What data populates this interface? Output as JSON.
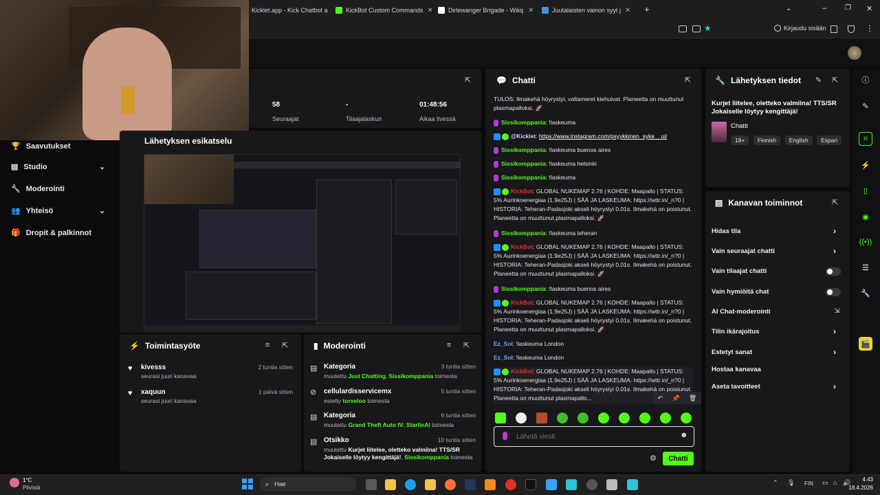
{
  "browser": {
    "tabs": [
      {
        "label": "Kicklet.app - Kick Chatbot a"
      },
      {
        "label": "KickBot Custom Commands"
      },
      {
        "label": "Dirlewanger Brigade - Wikipedi"
      },
      {
        "label": "Juutalaisten vainon syyt ja aika"
      }
    ],
    "signin_label": "Kirjaudu sisään"
  },
  "sidebar": {
    "items": [
      {
        "label": "Saavutukset"
      },
      {
        "label": "Studio"
      },
      {
        "label": "Moderointi"
      },
      {
        "label": "Yhteisö"
      },
      {
        "label": "Dropit & palkinnot"
      }
    ]
  },
  "stats": [
    {
      "value": "58",
      "label": "Seuraajat"
    },
    {
      "value": "-",
      "label": "Tilaajalaskuri"
    },
    {
      "value": "01:48:56",
      "label": "Aikaa livessä"
    }
  ],
  "preview": {
    "title": "Lähetyksen esikatselu"
  },
  "activity": {
    "title": "Toimintasyöte",
    "items": [
      {
        "name": "kivesss",
        "sub": "seurasi juuri kanavaa",
        "time": "2 tuntia sitten"
      },
      {
        "name": "xaquun",
        "sub": "seurasi juuri kanavaa",
        "time": "1 päivä sitten"
      }
    ]
  },
  "moderation": {
    "title": "Moderointi",
    "items": [
      {
        "title": "Kategoria",
        "prefix": "muutettu",
        "highlight": "Just Chatting",
        "user": "Sissikomppania",
        "suffix": "toimesta",
        "time": "3 tuntia sitten"
      },
      {
        "title": "cellulardisservicemx",
        "prefix": "estetty",
        "highlight": "",
        "user": "torveloo",
        "suffix": "toimesta",
        "time": "5 tuntia sitten"
      },
      {
        "title": "Kategoria",
        "prefix": "muutettu",
        "highlight": "Grand Theft Auto IV",
        "user": "StarlieAI",
        "suffix": "toimesta",
        "time": "6 tuntia sitten"
      },
      {
        "title": "Otsikko",
        "prefix": "muutettu",
        "highlight": "Kurjet liitelee, oletteko valmiina! TTS/SR Jokaiselle löytyy kengittäjä!",
        "user": "Sissikomppania",
        "suffix": "toimesta",
        "time": "10 tuntia sitten"
      }
    ]
  },
  "chat": {
    "title": "Chatti",
    "lines": [
      {
        "type": "sys",
        "text": "TULOS: Ilmakehä höyrystyi, valtameret kiehuivat. Planeetta on muuttunut plasmapalloksi. 🚀"
      },
      {
        "type": "user",
        "user": "Sissikomppania",
        "msg": "!laskeuma"
      },
      {
        "type": "kicklet",
        "user": "@Kicklet",
        "msg": "https://www.instagram.com/psyykkinen_syke__ui/"
      },
      {
        "type": "user",
        "user": "Sissikomppania",
        "msg": "!laskeuma buenos aires"
      },
      {
        "type": "user",
        "user": "Sissikomppania",
        "msg": "!laskeuma helsinki"
      },
      {
        "type": "user",
        "user": "Sissikomppania",
        "msg": "!laskeuma"
      },
      {
        "type": "bot",
        "user": "KickBot",
        "msg": "GLOBAL NUKEMAP 2.76 | KOHDE: Maapallo | STATUS: 5% Aurinkoenergiaa (1.9e25J) | SÄÄ JA LASKEUMA: https://wttr.in/_n?0 | HISTORIA: Teheran-Padasjoki akseli höyrystyi 0.01s. Ilmakehä on poistunut. Planeetta on muuttunut plasmapalloksi. 🚀"
      },
      {
        "type": "user",
        "user": "Sissikomppania",
        "msg": "!laskeuma teheran"
      },
      {
        "type": "bot",
        "user": "KickBot",
        "msg": "GLOBAL NUKEMAP 2.76 | KOHDE: Maapallo | STATUS: 5% Aurinkoenergiaa (1.9e25J) | SÄÄ JA LASKEUMA: https://wttr.in/_n?0 | HISTORIA: Teheran-Padasjoki akseli höyrystyi 0.01s. Ilmakehä on poistunut. Planeetta on muuttunut plasmapalloksi. 🚀"
      },
      {
        "type": "user",
        "user": "Sissikomppania",
        "msg": "!laskeuma buenos aires"
      },
      {
        "type": "bot",
        "user": "KickBot",
        "msg": "GLOBAL NUKEMAP 2.76 | KOHDE: Maapallo | STATUS: 5% Aurinkoenergiaa (1.9e25J) | SÄÄ JA LASKEUMA: https://wttr.in/_n?0 | HISTORIA: Teheran-Padasjoki akseli höyrystyi 0.01s. Ilmakehä on poistunut. Planeetta on muuttunut plasmapalloksi. 🚀"
      },
      {
        "type": "plain",
        "user": "Ez_Sol",
        "msg": "!laskeuma London"
      },
      {
        "type": "plain",
        "user": "Ez_Sol",
        "msg": "!laskeuma London"
      },
      {
        "type": "bot",
        "user": "KickBot",
        "msg": "GLOBAL NUKEMAP 2.76 | KOHDE: Maapallo | STATUS: 5% Aurinkoenergiaa (1.9e25J) | SÄÄ JA LASKEUMA: https://wttr.in/_n?0 | HISTORIA: Teheran-Padasjoki akseli höyrystyi 0.01s. Ilmakehä on poistunut. Planeetta on muuttunut plasmapallo..."
      }
    ],
    "input_placeholder": "Lähetä viesti",
    "send_label": "Chatti"
  },
  "stream_info": {
    "title": "Lähetyksen tiedot",
    "stream_title": "Kurjet liitelee, oletteko valmiina! TTS/SR Jokaiselle löytyy kengittäjä!",
    "category": "Chatti",
    "tags": [
      "18+",
      "Finnish",
      "English",
      "Espan"
    ]
  },
  "channel_ops": {
    "title": "Kanavan toiminnot",
    "items": [
      {
        "label": "Hidas tila"
      },
      {
        "label": "Vain seuraajat chatti"
      },
      {
        "label": "Vain tilaajat chatti"
      },
      {
        "label": "Vain hymiöitä chat"
      },
      {
        "label": "AI Chat-moderointi"
      },
      {
        "label": "Tilin ikärajoitus"
      },
      {
        "label": "Estetyt sanat"
      },
      {
        "label": "Hostaa kanavaa"
      },
      {
        "label": "Aseta tavoitteet"
      }
    ]
  },
  "taskbar": {
    "weather_temp": "1°C",
    "weather_desc": "Pilvistä",
    "search_label": "Hae",
    "lang": "FIN",
    "time": "4.43",
    "date": "18.4.2026"
  },
  "colors": {
    "accent": "#53fc18",
    "panel": "#18181b",
    "kickbot": "#e0312a"
  }
}
